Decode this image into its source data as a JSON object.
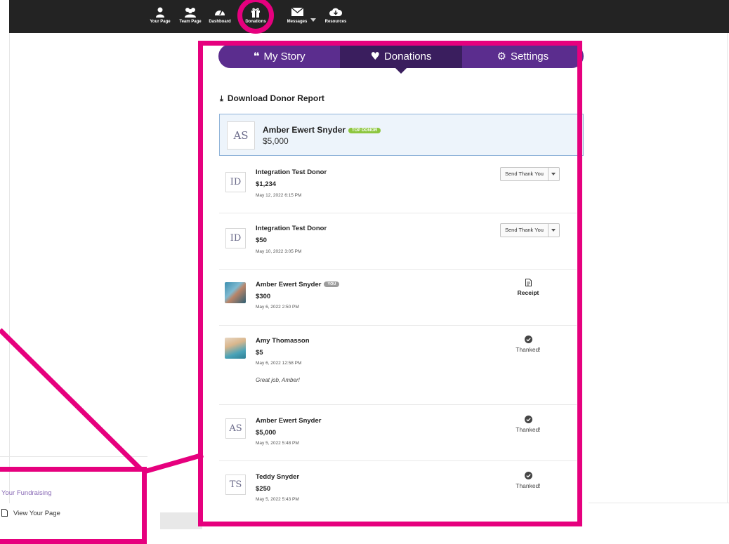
{
  "nav": {
    "items": [
      {
        "label": "Your Page",
        "icon": "user-icon"
      },
      {
        "label": "Team Page",
        "icon": "users-icon"
      },
      {
        "label": "Dashboard",
        "icon": "dashboard-icon"
      },
      {
        "label": "Donations",
        "icon": "gift-icon"
      },
      {
        "label": "Messages",
        "icon": "envelope-icon"
      },
      {
        "label": "Resources",
        "icon": "cloud-download-icon"
      }
    ]
  },
  "tabs": [
    {
      "label": "My Story",
      "icon": "quote-icon"
    },
    {
      "label": "Donations",
      "icon": "heart-icon",
      "active": true
    },
    {
      "label": "Settings",
      "icon": "gear-icon"
    }
  ],
  "download_label": "Download Donor Report",
  "top_donor": {
    "initials": "AS",
    "name": "Amber Ewert Snyder",
    "badge": "TOP DONOR",
    "amount": "$5,000"
  },
  "donations": [
    {
      "initials": "ID",
      "name": "Integration Test Donor",
      "amount": "$1,234",
      "date": "May 12, 2022 6:15 PM",
      "action": "Send Thank You"
    },
    {
      "initials": "ID",
      "name": "Integration Test Donor",
      "amount": "$50",
      "date": "May 10, 2022 3:05 PM",
      "action": "Send Thank You"
    },
    {
      "initials": "",
      "name": "Amber Ewert Snyder",
      "badge": "YOU",
      "amount": "$300",
      "date": "May 6, 2022 2:50 PM",
      "status": "Receipt"
    },
    {
      "initials": "",
      "name": "Amy Thomasson",
      "amount": "$5",
      "date": "May 6, 2022 12:58 PM",
      "message": "Great job, Amber!",
      "status": "Thanked!"
    },
    {
      "initials": "AS",
      "name": "Amber Ewert Snyder",
      "amount": "$5,000",
      "date": "May 5, 2022 5:48 PM",
      "status": "Thanked!"
    },
    {
      "initials": "TS",
      "name": "Teddy Snyder",
      "amount": "$250",
      "date": "May 5, 2022 5:43 PM",
      "status": "Thanked!"
    }
  ],
  "sidebar": {
    "title": "Your Fundraising",
    "link": "View Your Page"
  },
  "colors": {
    "highlight": "#e6007e",
    "tab_bg": "#5b2d8e",
    "tab_active": "#3a1e5e",
    "top_badge": "#8dc63f",
    "nav_bg": "#232323"
  }
}
